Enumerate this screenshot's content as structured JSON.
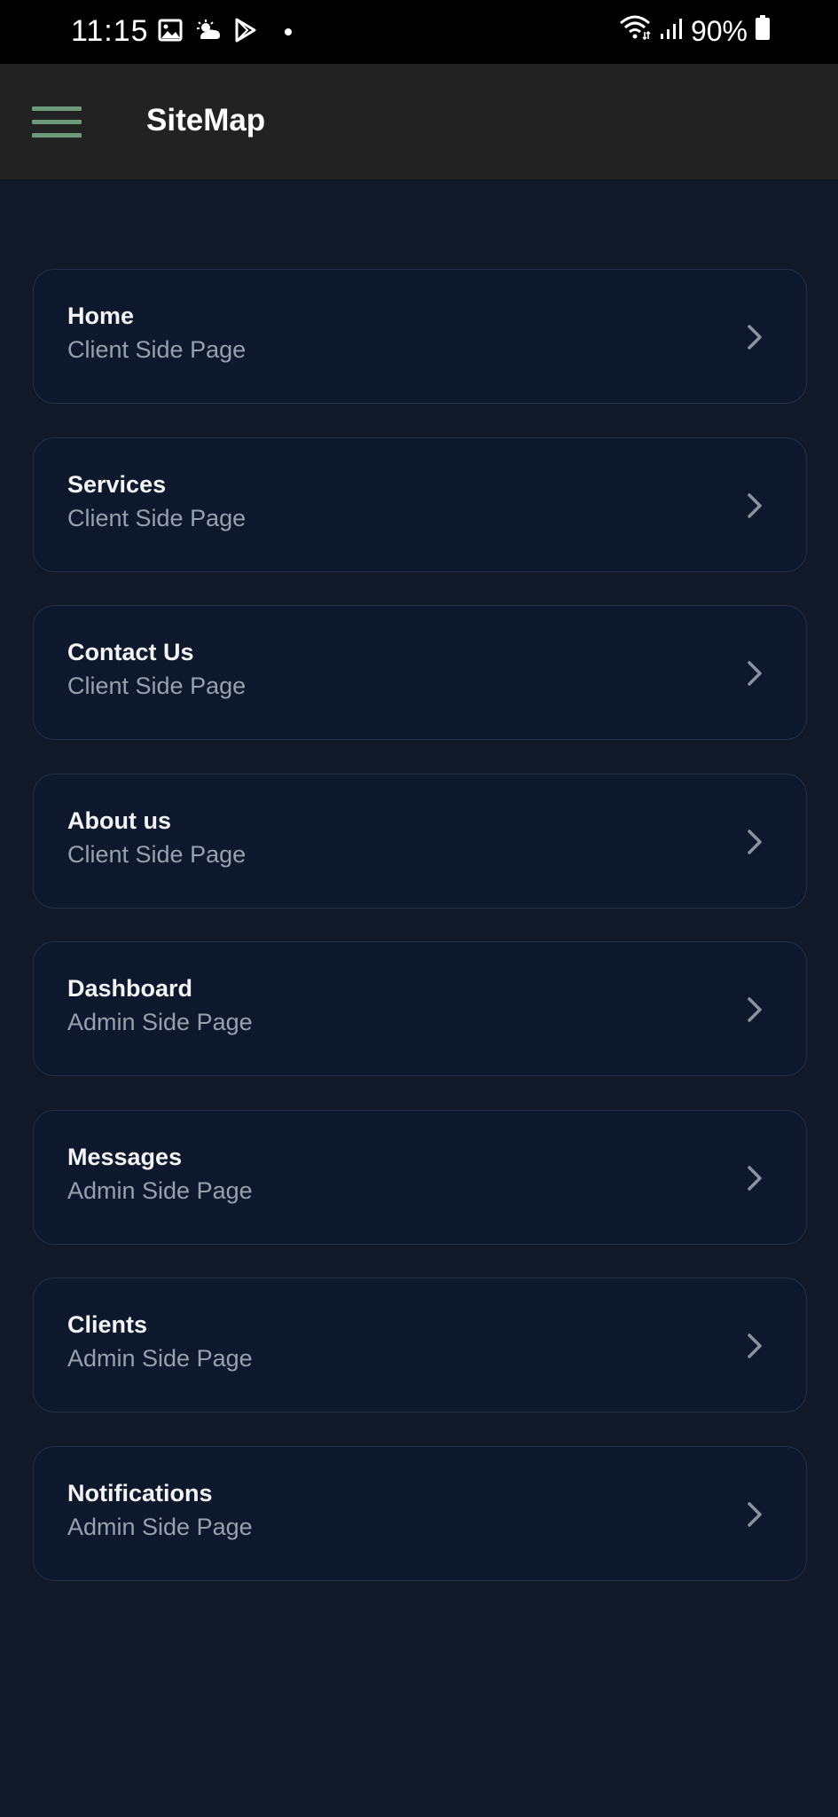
{
  "status_bar": {
    "time": "11:15",
    "left_icons": [
      "gallery-icon",
      "weather-icon",
      "play-store-icon",
      "dot-icon"
    ],
    "battery": "90%",
    "right_icons": [
      "wifi-icon",
      "signal-icon",
      "battery-icon"
    ]
  },
  "app_bar": {
    "menu_icon": "hamburger-menu-icon",
    "title": "SiteMap",
    "accent_color": "#6c9a7b"
  },
  "pages": [
    {
      "title": "Home",
      "subtitle": "Client Side Page"
    },
    {
      "title": "Services",
      "subtitle": "Client Side Page"
    },
    {
      "title": "Contact Us",
      "subtitle": "Client Side Page"
    },
    {
      "title": "About us",
      "subtitle": "Client Side Page"
    },
    {
      "title": "Dashboard",
      "subtitle": "Admin Side Page"
    },
    {
      "title": "Messages",
      "subtitle": "Admin Side Page"
    },
    {
      "title": "Clients",
      "subtitle": "Admin Side Page"
    },
    {
      "title": "Notifications",
      "subtitle": "Admin Side Page"
    }
  ],
  "colors": {
    "background": "#111827",
    "card": "#0d182d",
    "card_border": "#243047",
    "title_text": "#f3f4f6",
    "subtitle_text": "#98a0ad"
  }
}
